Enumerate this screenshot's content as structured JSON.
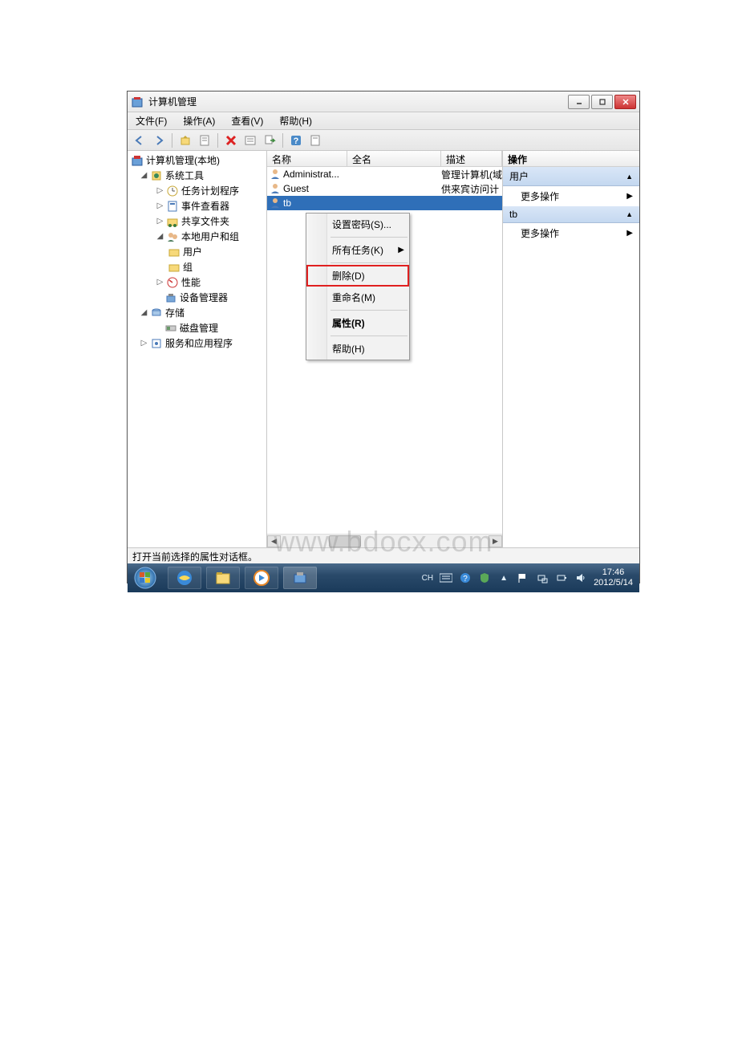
{
  "window": {
    "title": "计算机管理"
  },
  "menu": {
    "file": "文件(F)",
    "action": "操作(A)",
    "view": "查看(V)",
    "help": "帮助(H)"
  },
  "tree": {
    "root": "计算机管理(本地)",
    "systools": "系统工具",
    "scheduler": "任务计划程序",
    "eventviewer": "事件查看器",
    "sharedfolders": "共享文件夹",
    "localusers": "本地用户和组",
    "users": "用户",
    "groups": "组",
    "performance": "性能",
    "devicemgr": "设备管理器",
    "storage": "存储",
    "diskmgmt": "磁盘管理",
    "services": "服务和应用程序"
  },
  "list": {
    "col_name": "名称",
    "col_fullname": "全名",
    "col_desc": "描述",
    "rows": [
      {
        "name": "Administrat...",
        "full": "",
        "desc": "管理计算机(域"
      },
      {
        "name": "Guest",
        "full": "",
        "desc": "供来宾访问计"
      },
      {
        "name": "tb",
        "full": "",
        "desc": ""
      }
    ]
  },
  "contextmenu": {
    "setpassword": "设置密码(S)...",
    "alltasks": "所有任务(K)",
    "delete": "删除(D)",
    "rename": "重命名(M)",
    "properties": "属性(R)",
    "help": "帮助(H)"
  },
  "actions": {
    "header": "操作",
    "section1": "用户",
    "more1": "更多操作",
    "section2": "tb",
    "more2": "更多操作"
  },
  "status": "打开当前选择的属性对话框。",
  "tray": {
    "ime": "CH",
    "time": "17:46",
    "date": "2012/5/14"
  },
  "watermark": "www.bdocx.com"
}
